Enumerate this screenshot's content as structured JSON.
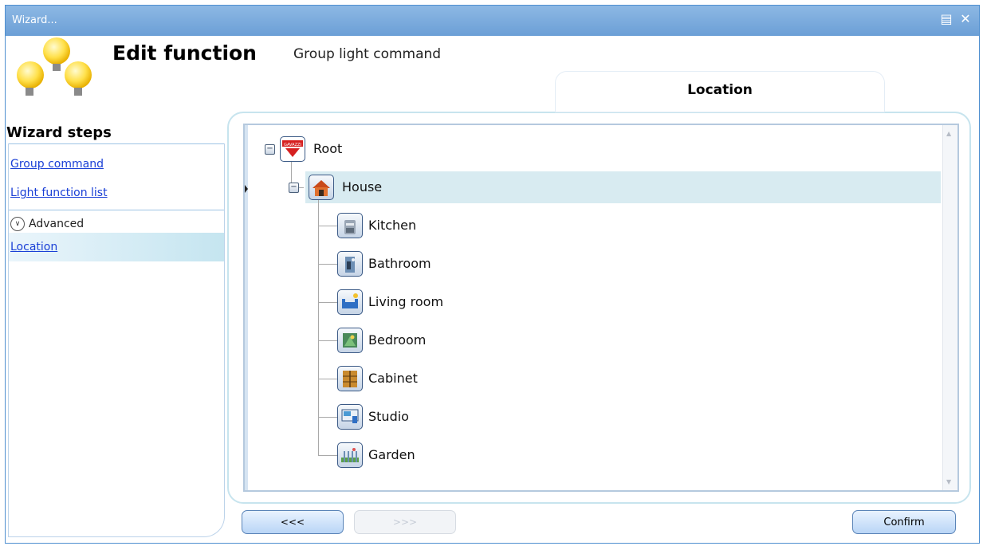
{
  "window": {
    "title": "Wizard...",
    "controls": {
      "restore_icon": "restore-icon",
      "close_icon": "close-icon"
    }
  },
  "header": {
    "title": "Edit function",
    "subtitle": "Group light command",
    "tab": "Location",
    "logo": "light-bulbs-icon"
  },
  "steps": {
    "title": "Wizard steps",
    "items": [
      {
        "label": "Group command",
        "link": true
      },
      {
        "label": "Light function list",
        "link": true
      }
    ],
    "advanced": {
      "label": "Advanced",
      "icon": "chevron-down-circle-icon"
    },
    "advanced_items": [
      {
        "label": "Location",
        "active": true
      }
    ]
  },
  "tree": {
    "root": {
      "label": "Root",
      "icon": "carlo-gavazzi-logo-icon",
      "expanded": true
    },
    "house": {
      "label": "House",
      "icon": "house-icon",
      "expanded": true,
      "selected": true
    },
    "rooms": [
      {
        "label": "Kitchen",
        "icon": "kitchen-icon"
      },
      {
        "label": "Bathroom",
        "icon": "bathroom-icon"
      },
      {
        "label": "Living room",
        "icon": "living-room-icon"
      },
      {
        "label": "Bedroom",
        "icon": "bedroom-icon"
      },
      {
        "label": "Cabinet",
        "icon": "cabinet-icon"
      },
      {
        "label": "Studio",
        "icon": "studio-icon"
      },
      {
        "label": "Garden",
        "icon": "garden-icon"
      }
    ]
  },
  "buttons": {
    "prev": "<<<",
    "next": ">>>",
    "confirm": "Confirm"
  },
  "colors": {
    "titlebar": "#7aa9dd",
    "accent_border": "#c7e4ee",
    "selection": "#d8ebf1",
    "link": "#1a3fd6"
  }
}
